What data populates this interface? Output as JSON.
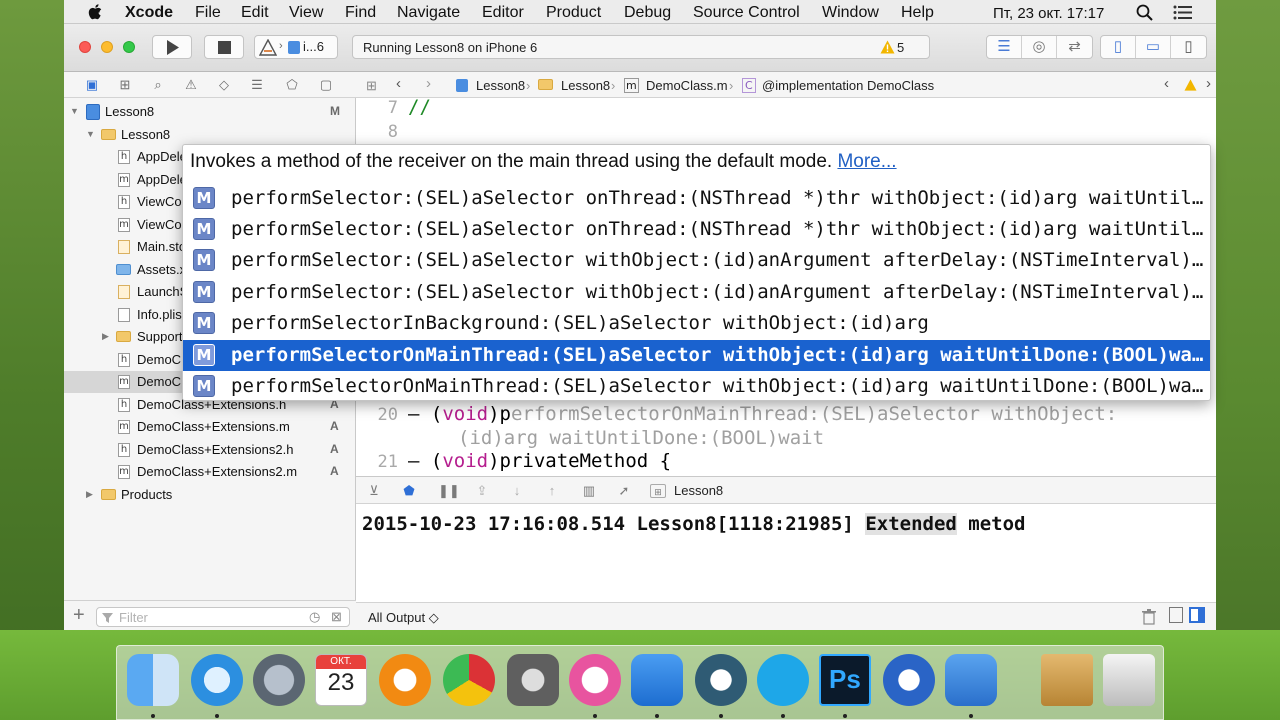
{
  "menubar": {
    "items": [
      "Xcode",
      "File",
      "Edit",
      "View",
      "Find",
      "Navigate",
      "Editor",
      "Product",
      "Debug",
      "Source Control",
      "Window",
      "Help"
    ],
    "clock": "Пт, 23 окт.  17:17"
  },
  "toolbar": {
    "scheme": "i...6",
    "activity": "Running Lesson8 on iPhone 6",
    "warnings": "5"
  },
  "navigator": {
    "items": [
      {
        "label": "Lesson8",
        "status": "M"
      },
      {
        "label": "Lesson8",
        "status": ""
      },
      {
        "label": "AppDele",
        "status": ""
      },
      {
        "label": "AppDele",
        "status": ""
      },
      {
        "label": "ViewCo",
        "status": ""
      },
      {
        "label": "ViewCo",
        "status": ""
      },
      {
        "label": "Main.sto",
        "status": ""
      },
      {
        "label": "Assets.x",
        "status": ""
      },
      {
        "label": "LaunchS",
        "status": ""
      },
      {
        "label": "Info.plis",
        "status": ""
      },
      {
        "label": "Support",
        "status": ""
      },
      {
        "label": "DemoCl",
        "status": ""
      },
      {
        "label": "DemoCl",
        "status": ""
      },
      {
        "label": "DemoClass+Extensions.h",
        "status": "A"
      },
      {
        "label": "DemoClass+Extensions.m",
        "status": "A"
      },
      {
        "label": "DemoClass+Extensions2.h",
        "status": "A"
      },
      {
        "label": "DemoClass+Extensions2.m",
        "status": "A"
      },
      {
        "label": "Products",
        "status": ""
      }
    ],
    "filter_placeholder": "Filter"
  },
  "jumpbar": {
    "crumbs": [
      "Lesson8",
      "Lesson8",
      "DemoClass.m",
      "@implementation DemoClass"
    ]
  },
  "editor": {
    "line7_num": "7",
    "line7_code": "//",
    "line8_num": "8",
    "line20_num": "20",
    "line20_dash": "– (",
    "line20_void": "void",
    "line20_close": ")p",
    "line20_ghost": "erformSelectorOnMainThread:(SEL)aSelector withObject:",
    "line20_cont": "(id)arg waitUntilDone:(BOOL)wait",
    "line21_num": "21",
    "line21_dash": "– (",
    "line21_void": "void",
    "line21_rest": ")privateMethod {"
  },
  "completion": {
    "description": "Invokes a method of the receiver on the main thread using the default mode.",
    "more": "More...",
    "badge": "M",
    "items": [
      "performSelector:(SEL)aSelector onThread:(NSThread *)thr withObject:(id)arg waitUntilDone:(BOOL)wait",
      "performSelector:(SEL)aSelector onThread:(NSThread *)thr withObject:(id)arg waitUntilDone:(BOOL)wait modes:(NSArray *)array",
      "performSelector:(SEL)aSelector withObject:(id)anArgument afterDelay:(NSTimeInterval)delay",
      "performSelector:(SEL)aSelector withObject:(id)anArgument afterDelay:(NSTimeInterval)delay inModes:(NSArray *)modes",
      "performSelectorInBackground:(SEL)aSelector withObject:(id)arg",
      "performSelectorOnMainThread:(SEL)aSelector withObject:(id)arg waitUntilDone:(BOOL)wait",
      "performSelectorOnMainThread:(SEL)aSelector withObject:(id)arg waitUntilDone:(BOOL)wait modes:(NSArray *)array"
    ],
    "selected_index": 5
  },
  "debug": {
    "target": "Lesson8",
    "console_prefix": "2015-10-23 17:16:08.514 Lesson8[1118:21985] ",
    "console_highlight": "Extended",
    "console_suffix": " metod",
    "output_selector": "All Output ◇"
  },
  "dock": {
    "calendar_month": "ОКТ.",
    "calendar_day": "23",
    "ps_label": "Ps"
  },
  "colors": {
    "selection": "#1a62cf",
    "keyword": "#b51e8e",
    "accent": "#4a7bd6"
  }
}
